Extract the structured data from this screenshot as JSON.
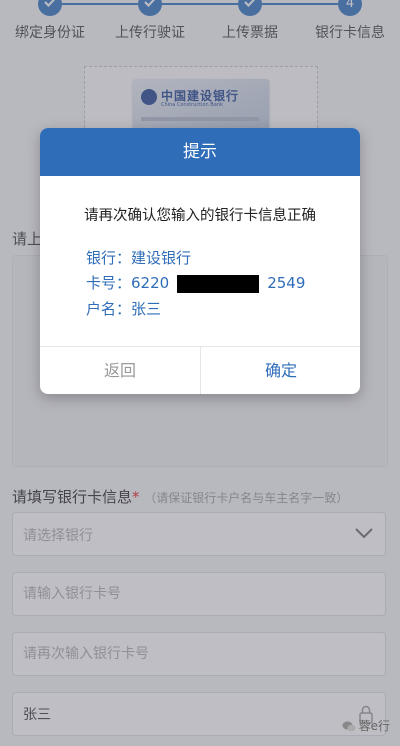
{
  "stepper": {
    "steps": [
      {
        "label": "绑定身份证",
        "state": "done"
      },
      {
        "label": "上传行驶证",
        "state": "done"
      },
      {
        "label": "上传票据",
        "state": "done"
      },
      {
        "label": "银行卡信息",
        "state": "current",
        "number": "4"
      }
    ],
    "active_color": "#2a6fc0"
  },
  "upload": {
    "card_bank_name": "中国建设银行",
    "card_bank_en": "China Construction Bank",
    "section_label": "请上"
  },
  "form": {
    "title": "请填写银行卡信息",
    "required_mark": "*",
    "hint": "（请保证银行卡户名与车主名字一致）",
    "bank_select_placeholder": "请选择银行",
    "card_number_placeholder": "请输入银行卡号",
    "card_number_confirm_placeholder": "请再次输入银行卡号",
    "holder_name_value": "张三"
  },
  "dialog": {
    "title": "提示",
    "message": "请再次确认您输入的银行卡信息正确",
    "bank_line": "银行：建设银行",
    "card_prefix": "卡号：6220",
    "card_suffix": "2549",
    "name_line": "户名：张三",
    "back_label": "返回",
    "confirm_label": "确定",
    "header_color": "#2f6db8"
  },
  "watermark": {
    "text": "蓉e行"
  }
}
